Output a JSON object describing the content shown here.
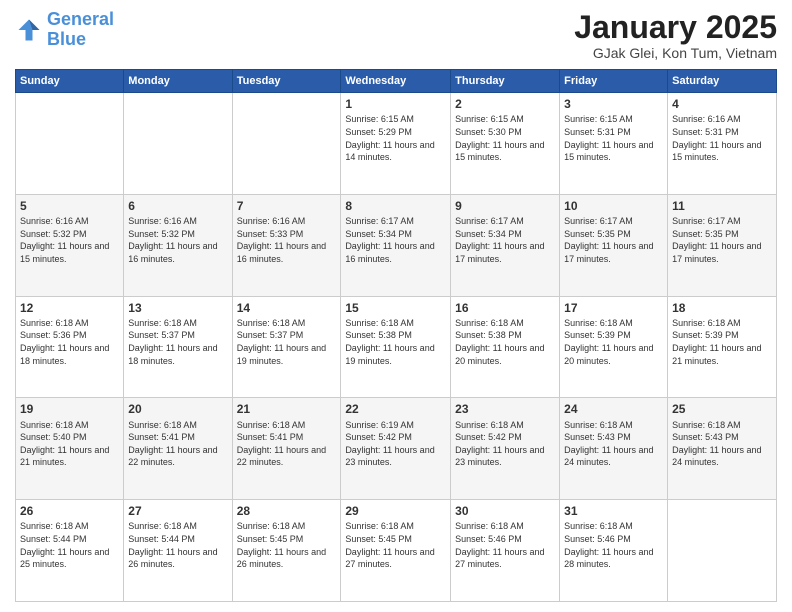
{
  "logo": {
    "line1": "General",
    "line2": "Blue"
  },
  "title": "January 2025",
  "subtitle": "GJak Glei, Kon Tum, Vietnam",
  "weekdays": [
    "Sunday",
    "Monday",
    "Tuesday",
    "Wednesday",
    "Thursday",
    "Friday",
    "Saturday"
  ],
  "weeks": [
    [
      {
        "day": "",
        "info": ""
      },
      {
        "day": "",
        "info": ""
      },
      {
        "day": "",
        "info": ""
      },
      {
        "day": "1",
        "info": "Sunrise: 6:15 AM\nSunset: 5:29 PM\nDaylight: 11 hours and 14 minutes."
      },
      {
        "day": "2",
        "info": "Sunrise: 6:15 AM\nSunset: 5:30 PM\nDaylight: 11 hours and 15 minutes."
      },
      {
        "day": "3",
        "info": "Sunrise: 6:15 AM\nSunset: 5:31 PM\nDaylight: 11 hours and 15 minutes."
      },
      {
        "day": "4",
        "info": "Sunrise: 6:16 AM\nSunset: 5:31 PM\nDaylight: 11 hours and 15 minutes."
      }
    ],
    [
      {
        "day": "5",
        "info": "Sunrise: 6:16 AM\nSunset: 5:32 PM\nDaylight: 11 hours and 15 minutes."
      },
      {
        "day": "6",
        "info": "Sunrise: 6:16 AM\nSunset: 5:32 PM\nDaylight: 11 hours and 16 minutes."
      },
      {
        "day": "7",
        "info": "Sunrise: 6:16 AM\nSunset: 5:33 PM\nDaylight: 11 hours and 16 minutes."
      },
      {
        "day": "8",
        "info": "Sunrise: 6:17 AM\nSunset: 5:34 PM\nDaylight: 11 hours and 16 minutes."
      },
      {
        "day": "9",
        "info": "Sunrise: 6:17 AM\nSunset: 5:34 PM\nDaylight: 11 hours and 17 minutes."
      },
      {
        "day": "10",
        "info": "Sunrise: 6:17 AM\nSunset: 5:35 PM\nDaylight: 11 hours and 17 minutes."
      },
      {
        "day": "11",
        "info": "Sunrise: 6:17 AM\nSunset: 5:35 PM\nDaylight: 11 hours and 17 minutes."
      }
    ],
    [
      {
        "day": "12",
        "info": "Sunrise: 6:18 AM\nSunset: 5:36 PM\nDaylight: 11 hours and 18 minutes."
      },
      {
        "day": "13",
        "info": "Sunrise: 6:18 AM\nSunset: 5:37 PM\nDaylight: 11 hours and 18 minutes."
      },
      {
        "day": "14",
        "info": "Sunrise: 6:18 AM\nSunset: 5:37 PM\nDaylight: 11 hours and 19 minutes."
      },
      {
        "day": "15",
        "info": "Sunrise: 6:18 AM\nSunset: 5:38 PM\nDaylight: 11 hours and 19 minutes."
      },
      {
        "day": "16",
        "info": "Sunrise: 6:18 AM\nSunset: 5:38 PM\nDaylight: 11 hours and 20 minutes."
      },
      {
        "day": "17",
        "info": "Sunrise: 6:18 AM\nSunset: 5:39 PM\nDaylight: 11 hours and 20 minutes."
      },
      {
        "day": "18",
        "info": "Sunrise: 6:18 AM\nSunset: 5:39 PM\nDaylight: 11 hours and 21 minutes."
      }
    ],
    [
      {
        "day": "19",
        "info": "Sunrise: 6:18 AM\nSunset: 5:40 PM\nDaylight: 11 hours and 21 minutes."
      },
      {
        "day": "20",
        "info": "Sunrise: 6:18 AM\nSunset: 5:41 PM\nDaylight: 11 hours and 22 minutes."
      },
      {
        "day": "21",
        "info": "Sunrise: 6:18 AM\nSunset: 5:41 PM\nDaylight: 11 hours and 22 minutes."
      },
      {
        "day": "22",
        "info": "Sunrise: 6:19 AM\nSunset: 5:42 PM\nDaylight: 11 hours and 23 minutes."
      },
      {
        "day": "23",
        "info": "Sunrise: 6:18 AM\nSunset: 5:42 PM\nDaylight: 11 hours and 23 minutes."
      },
      {
        "day": "24",
        "info": "Sunrise: 6:18 AM\nSunset: 5:43 PM\nDaylight: 11 hours and 24 minutes."
      },
      {
        "day": "25",
        "info": "Sunrise: 6:18 AM\nSunset: 5:43 PM\nDaylight: 11 hours and 24 minutes."
      }
    ],
    [
      {
        "day": "26",
        "info": "Sunrise: 6:18 AM\nSunset: 5:44 PM\nDaylight: 11 hours and 25 minutes."
      },
      {
        "day": "27",
        "info": "Sunrise: 6:18 AM\nSunset: 5:44 PM\nDaylight: 11 hours and 26 minutes."
      },
      {
        "day": "28",
        "info": "Sunrise: 6:18 AM\nSunset: 5:45 PM\nDaylight: 11 hours and 26 minutes."
      },
      {
        "day": "29",
        "info": "Sunrise: 6:18 AM\nSunset: 5:45 PM\nDaylight: 11 hours and 27 minutes."
      },
      {
        "day": "30",
        "info": "Sunrise: 6:18 AM\nSunset: 5:46 PM\nDaylight: 11 hours and 27 minutes."
      },
      {
        "day": "31",
        "info": "Sunrise: 6:18 AM\nSunset: 5:46 PM\nDaylight: 11 hours and 28 minutes."
      },
      {
        "day": "",
        "info": ""
      }
    ]
  ]
}
